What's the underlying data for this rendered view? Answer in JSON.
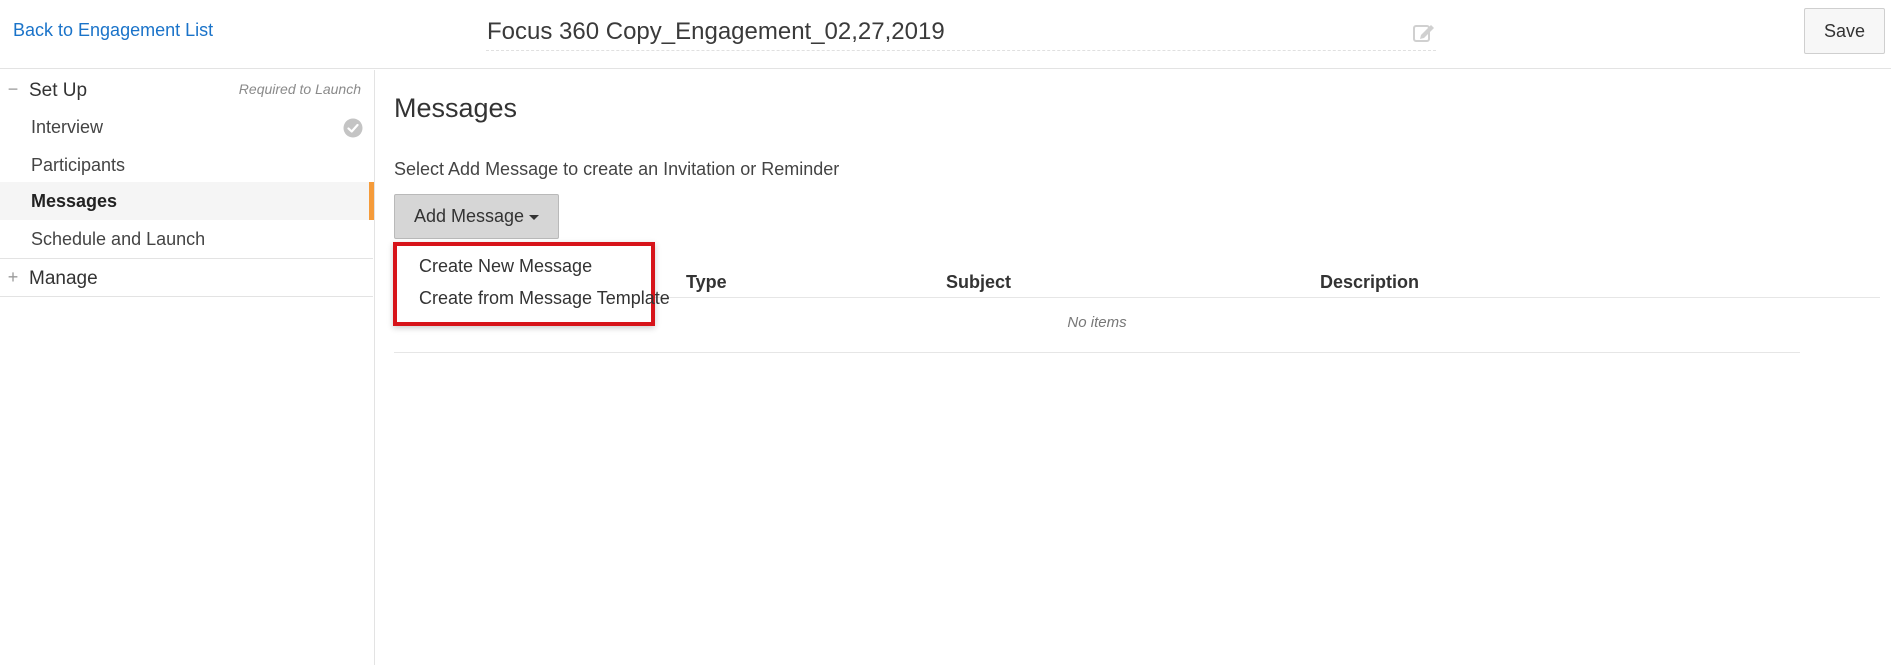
{
  "header": {
    "back_link": "Back to Engagement List",
    "engagement_title": "Focus 360 Copy_Engagement_02,27,2019",
    "save_label": "Save"
  },
  "sidebar": {
    "setup": {
      "sign": "−",
      "label": "Set Up",
      "hint": "Required to Launch",
      "items": [
        {
          "label": "Interview",
          "completed": true
        },
        {
          "label": "Participants"
        },
        {
          "label": "Messages",
          "active": true
        },
        {
          "label": "Schedule and Launch"
        }
      ]
    },
    "manage": {
      "sign": "+",
      "label": "Manage"
    }
  },
  "main": {
    "title": "Messages",
    "instructions": "Select Add Message to create an Invitation or Reminder",
    "add_button": "Add Message",
    "dropdown": [
      "Create New Message",
      "Create from Message Template"
    ],
    "table": {
      "columns": [
        "Type",
        "Subject",
        "Description"
      ],
      "empty_text": "No items"
    }
  },
  "colors": {
    "link": "#1a73c9",
    "active_accent": "#f59b3a",
    "highlight_border": "#d7141a"
  }
}
